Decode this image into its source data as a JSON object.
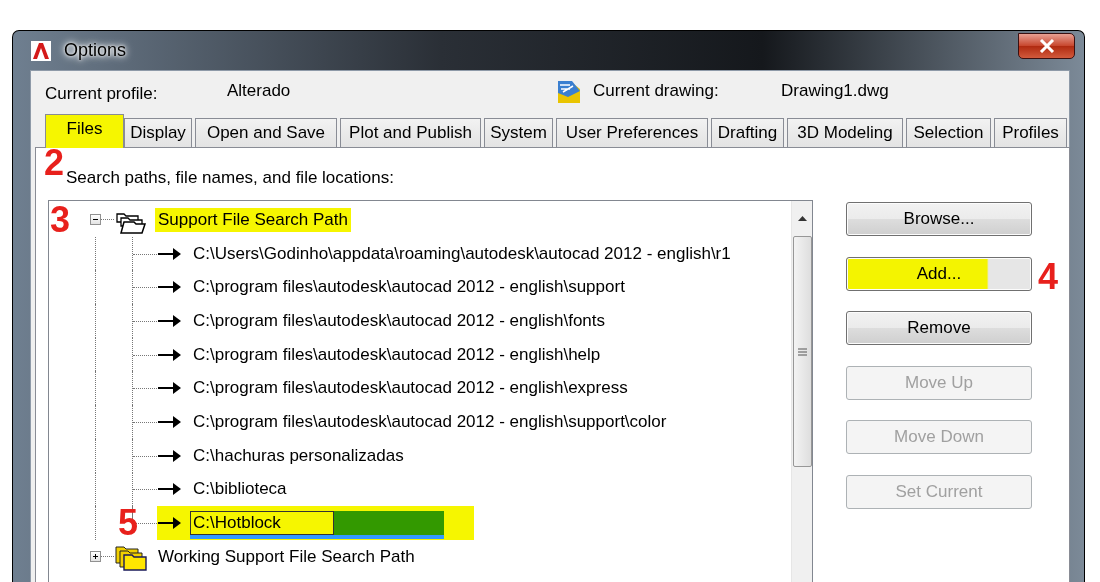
{
  "window": {
    "title": "Options"
  },
  "profile": {
    "label": "Current profile:",
    "value": "Alterado"
  },
  "drawing": {
    "label": "Current drawing:",
    "value": "Drawing1.dwg"
  },
  "tabs": [
    {
      "label": "Files",
      "selected": true,
      "highlighted": true
    },
    {
      "label": "Display",
      "selected": false,
      "highlighted": false
    },
    {
      "label": "Open and Save",
      "selected": false,
      "highlighted": false
    },
    {
      "label": "Plot and Publish",
      "selected": false,
      "highlighted": false
    },
    {
      "label": "System",
      "selected": false,
      "highlighted": false
    },
    {
      "label": "User Preferences",
      "selected": false,
      "highlighted": false
    },
    {
      "label": "Drafting",
      "selected": false,
      "highlighted": false
    },
    {
      "label": "3D Modeling",
      "selected": false,
      "highlighted": false
    },
    {
      "label": "Selection",
      "selected": false,
      "highlighted": false
    },
    {
      "label": "Profiles",
      "selected": false,
      "highlighted": false
    }
  ],
  "section_label": "Search paths, file names, and file locations:",
  "tree": [
    {
      "label": "Support File Search Path",
      "expanded": true,
      "highlighted": true,
      "children": [
        {
          "label": "C:\\Users\\Godinho\\appdata\\roaming\\autodesk\\autocad 2012 - english\\r1",
          "selected": false,
          "editing": false,
          "highlighted": false
        },
        {
          "label": "C:\\program files\\autodesk\\autocad 2012 - english\\support",
          "selected": false,
          "editing": false,
          "highlighted": false
        },
        {
          "label": "C:\\program files\\autodesk\\autocad 2012 - english\\fonts",
          "selected": false,
          "editing": false,
          "highlighted": false
        },
        {
          "label": "C:\\program files\\autodesk\\autocad 2012 - english\\help",
          "selected": false,
          "editing": false,
          "highlighted": false
        },
        {
          "label": "C:\\program files\\autodesk\\autocad 2012 - english\\express",
          "selected": false,
          "editing": false,
          "highlighted": false
        },
        {
          "label": "C:\\program files\\autodesk\\autocad 2012 - english\\support\\color",
          "selected": false,
          "editing": false,
          "highlighted": false
        },
        {
          "label": "C:\\hachuras personalizadas",
          "selected": false,
          "editing": false,
          "highlighted": false
        },
        {
          "label": "C:\\biblioteca",
          "selected": false,
          "editing": false,
          "highlighted": false
        },
        {
          "label": "C:\\Hotblock",
          "selected": true,
          "editing": true,
          "highlighted": true
        }
      ]
    },
    {
      "label": "Working Support File Search Path",
      "expanded": false,
      "highlighted": false
    }
  ],
  "buttons": [
    {
      "label": "Browse...",
      "disabled": false,
      "highlighted": false
    },
    {
      "label": "Add...",
      "disabled": false,
      "highlighted": true
    },
    {
      "label": "Remove",
      "disabled": false,
      "highlighted": false
    },
    {
      "label": "Move Up",
      "disabled": true,
      "highlighted": false
    },
    {
      "label": "Move Down",
      "disabled": true,
      "highlighted": false
    },
    {
      "label": "Set Current",
      "disabled": true,
      "highlighted": false
    }
  ],
  "callouts": [
    "2",
    "3",
    "4",
    "5"
  ]
}
